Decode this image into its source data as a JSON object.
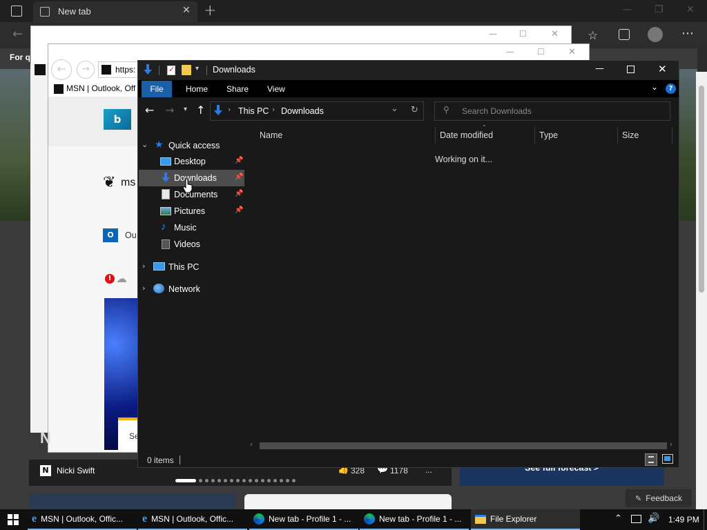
{
  "browser_back": {
    "tab_title": "New tab",
    "favorites_partial": "For q",
    "feed_source": "Nicki Swift",
    "likes": "328",
    "comments": "1178",
    "more": "...",
    "forecast_button": "See full forecast >",
    "feedback": "Feedback",
    "msn_logo_text": "ms",
    "outlook_partial": "Ou",
    "promo_partial": "Se",
    "story_partial": "N"
  },
  "ie_window": {
    "address_partial": "https:",
    "tab_title": "MSN | Outlook, Off"
  },
  "explorer": {
    "title": "Downloads",
    "ribbon_tabs": [
      "File",
      "Home",
      "Share",
      "View"
    ],
    "breadcrumb": [
      "This PC",
      "Downloads"
    ],
    "search_placeholder": "Search Downloads",
    "nav": {
      "quick_access": "Quick access",
      "items": [
        "Desktop",
        "Downloads",
        "Documents",
        "Pictures",
        "Music",
        "Videos"
      ],
      "this_pc": "This PC",
      "network": "Network"
    },
    "columns": [
      "Name",
      "Date modified",
      "Type",
      "Size"
    ],
    "status_message": "Working on it...",
    "status_bar": "0 items"
  },
  "taskbar": {
    "items": [
      "MSN | Outlook, Offic...",
      "MSN | Outlook, Offic...",
      "New tab - Profile 1 - ...",
      "New tab - Profile 1 - ...",
      "File Explorer"
    ],
    "time": "1:49 PM"
  },
  "colors": {
    "accent_blue": "#0078d4",
    "explorer_bg": "#191919",
    "taskbar_bg": "#101010"
  }
}
